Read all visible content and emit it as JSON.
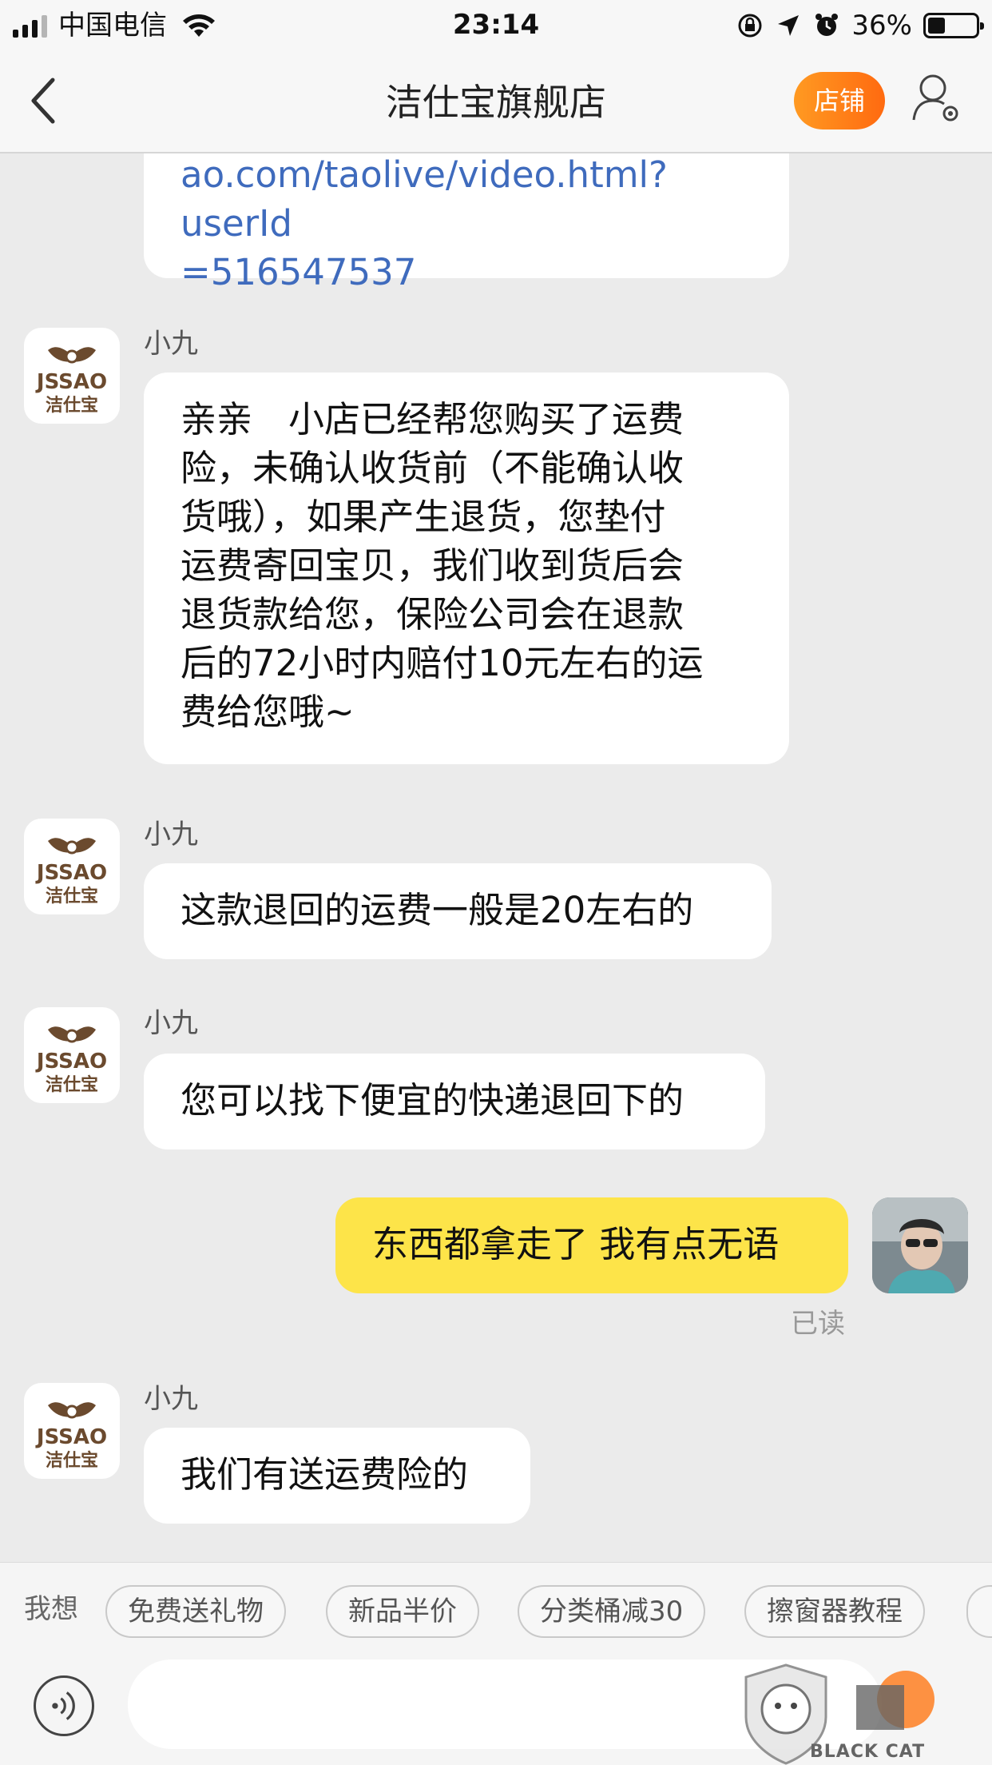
{
  "status_bar": {
    "carrier": "中国电信",
    "time": "23:14",
    "battery_pct": "36%",
    "battery_level": 0.36
  },
  "nav": {
    "title": "洁仕宝旗舰店",
    "shop_button": "店铺",
    "icons": [
      "back-arrow-icon",
      "user-settings-icon"
    ]
  },
  "messages": [
    {
      "type": "link",
      "lines": [
        "ao.com/taolive/video.html?userId",
        "=516547537"
      ]
    },
    {
      "sender": "小九",
      "text": [
        "亲亲　小店已经帮您购买了运费",
        "险，未确认收货前（不能确认收",
        "货哦），如果产生退货，您垫付",
        "运费寄回宝贝，我们收到货后会",
        "退货款给您，保险公司会在退款",
        "后的72小时内赔付10元左右的运",
        "费给您哦~"
      ]
    },
    {
      "sender": "小九",
      "text": "这款退回的运费一般是20左右的"
    },
    {
      "sender": "小九",
      "text": "您可以找下便宜的快递退回下的"
    },
    {
      "sender": "me",
      "text": "东西都拿走了 我有点无语",
      "status": "已读"
    },
    {
      "sender": "小九",
      "text": "我们有送运费险的"
    }
  ],
  "avatar_logo": {
    "brand_en": "JSSAO",
    "brand_cn": "洁仕宝"
  },
  "quick_bar": {
    "label": "我想",
    "chips": [
      "免费送礼物",
      "新品半价",
      "分类桶减30",
      "擦窗器教程"
    ]
  },
  "input": {
    "placeholder": ""
  },
  "watermark": {
    "text": "BLACK CAT"
  },
  "colors": {
    "accent_orange": "#ff7a14",
    "my_bubble": "#fde449",
    "link": "#3f6bbd",
    "background": "#ebebeb"
  }
}
